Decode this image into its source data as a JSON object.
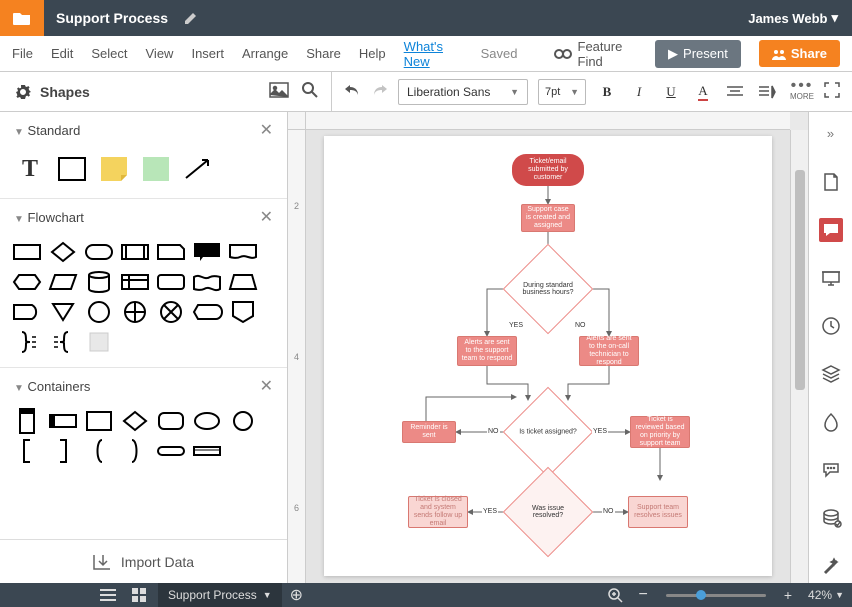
{
  "header": {
    "title": "Support Process",
    "user": "James Webb"
  },
  "menu": {
    "file": "File",
    "edit": "Edit",
    "select": "Select",
    "view": "View",
    "insert": "Insert",
    "arrange": "Arrange",
    "share": "Share",
    "help": "Help",
    "whats_new": "What's New",
    "saved": "Saved",
    "feature_find": "Feature Find",
    "present": "Present",
    "share_btn": "Share"
  },
  "toolbar": {
    "shapes": "Shapes",
    "font": "Liberation Sans",
    "size": "7pt",
    "more": "MORE"
  },
  "panels": {
    "standard": "Standard",
    "flowchart": "Flowchart",
    "containers": "Containers",
    "import": "Import Data"
  },
  "ruler_v": [
    "2",
    "4",
    "6"
  ],
  "flow": {
    "n1": "Ticket/email submitted by customer",
    "n2": "Support case is created and assigned",
    "d1": "During standard business hours?",
    "e_yes": "YES",
    "e_no": "NO",
    "n3": "Alerts are sent to the support team to respond",
    "n4": "Alerts are sent to the on-call technician to respond",
    "d2": "Is ticket assigned?",
    "n5": "Reminder is sent",
    "n6": "Ticket is reviewed based on priority by support team",
    "d3": "Was issue resolved?",
    "n7": "Ticket is closed and system sends follow up email",
    "n8": "Support team resolves issues"
  },
  "footer": {
    "tab": "Support Process",
    "zoom": "42%"
  },
  "chart_data": {
    "type": "flowchart",
    "nodes": [
      {
        "id": "n1",
        "kind": "terminator",
        "label": "Ticket/email submitted by customer"
      },
      {
        "id": "n2",
        "kind": "process",
        "label": "Support case is created and assigned"
      },
      {
        "id": "d1",
        "kind": "decision",
        "label": "During standard business hours?"
      },
      {
        "id": "n3",
        "kind": "process",
        "label": "Alerts are sent to the support team to respond"
      },
      {
        "id": "n4",
        "kind": "process",
        "label": "Alerts are sent to the on-call technician to respond"
      },
      {
        "id": "d2",
        "kind": "decision",
        "label": "Is ticket assigned?"
      },
      {
        "id": "n5",
        "kind": "process",
        "label": "Reminder is sent"
      },
      {
        "id": "n6",
        "kind": "process",
        "label": "Ticket is reviewed based on priority by support team"
      },
      {
        "id": "d3",
        "kind": "decision",
        "label": "Was issue resolved?"
      },
      {
        "id": "n7",
        "kind": "process",
        "label": "Ticket is closed and system sends follow up email"
      },
      {
        "id": "n8",
        "kind": "process",
        "label": "Support team resolves issues"
      }
    ],
    "edges": [
      {
        "from": "n1",
        "to": "n2"
      },
      {
        "from": "n2",
        "to": "d1"
      },
      {
        "from": "d1",
        "to": "n3",
        "label": "YES"
      },
      {
        "from": "d1",
        "to": "n4",
        "label": "NO"
      },
      {
        "from": "n3",
        "to": "d2"
      },
      {
        "from": "n4",
        "to": "d2"
      },
      {
        "from": "d2",
        "to": "n5",
        "label": "NO"
      },
      {
        "from": "d2",
        "to": "n6",
        "label": "YES"
      },
      {
        "from": "n6",
        "to": "d3"
      },
      {
        "from": "d3",
        "to": "n7",
        "label": "YES"
      },
      {
        "from": "d3",
        "to": "n8",
        "label": "NO"
      },
      {
        "from": "n5",
        "to": "d2"
      }
    ]
  }
}
